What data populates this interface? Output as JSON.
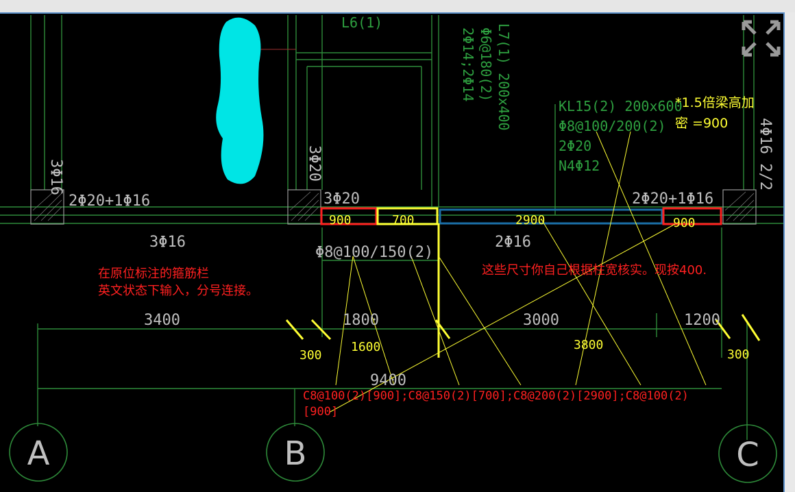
{
  "drawing": {
    "labels": {
      "L6": "L6(1)",
      "L7_line1": "L7(1) 200x400",
      "L7_line2": "Φ6@180(2)",
      "L7_line3": "2Φ14;2Φ14",
      "col_3f16_left": "3Φ16",
      "col_3f20_mid": "3Φ20",
      "top_left_rebar": "2Φ20+1Φ16",
      "top_mid_rebar": "3Φ20",
      "top_right_rebar": "2Φ20+1Φ16",
      "right_vert": "4Φ16 2/2",
      "bottom_left_rebar": "3Φ16",
      "bottom_mid_rebar": "2Φ16",
      "stirrup_mid": "Φ8@100/150(2)"
    },
    "kl15": {
      "line1": "KL15(2) 200x600",
      "line2": "Φ8@100/200(2)",
      "line3": "2Φ20",
      "line4": "N4Φ12"
    },
    "segments": {
      "seg1": "900",
      "seg2": "700",
      "seg3": "2900",
      "seg4": "900"
    },
    "dimensions": {
      "d3400": "3400",
      "d1800": "1800",
      "d3000": "3000",
      "d1200": "1200",
      "d9400": "9400"
    },
    "annotations": {
      "note_density_line1": "*1.5倍梁高加",
      "note_density_line2": "密  =900",
      "note_left_line1": "在原位标注的箍筋栏",
      "note_left_line2": "英文状态下输入，分号连接。",
      "note_right": "这些尺寸你自己根据柱宽核实。现按400.",
      "val_300_left": "300",
      "val_1600": "1600",
      "val_3800": "3800",
      "val_300_right": "300",
      "formula_line1": "C8@100(2)[900];C8@150(2)[700];C8@200(2)[2900];C8@100(2)",
      "formula_line2": "[900]"
    },
    "axes": {
      "a": "A",
      "b": "B",
      "c": "C"
    },
    "colors": {
      "background": "#000000",
      "line_green": "#2e8b3a",
      "text_yellow": "#ffff33",
      "text_red": "#ff2020",
      "text_gray": "#bfbfbf",
      "cyan": "#00e5e5",
      "blue_box": "#1b6fa8"
    },
    "toolbar": {
      "expand_icon": "fullscreen-icon"
    }
  }
}
